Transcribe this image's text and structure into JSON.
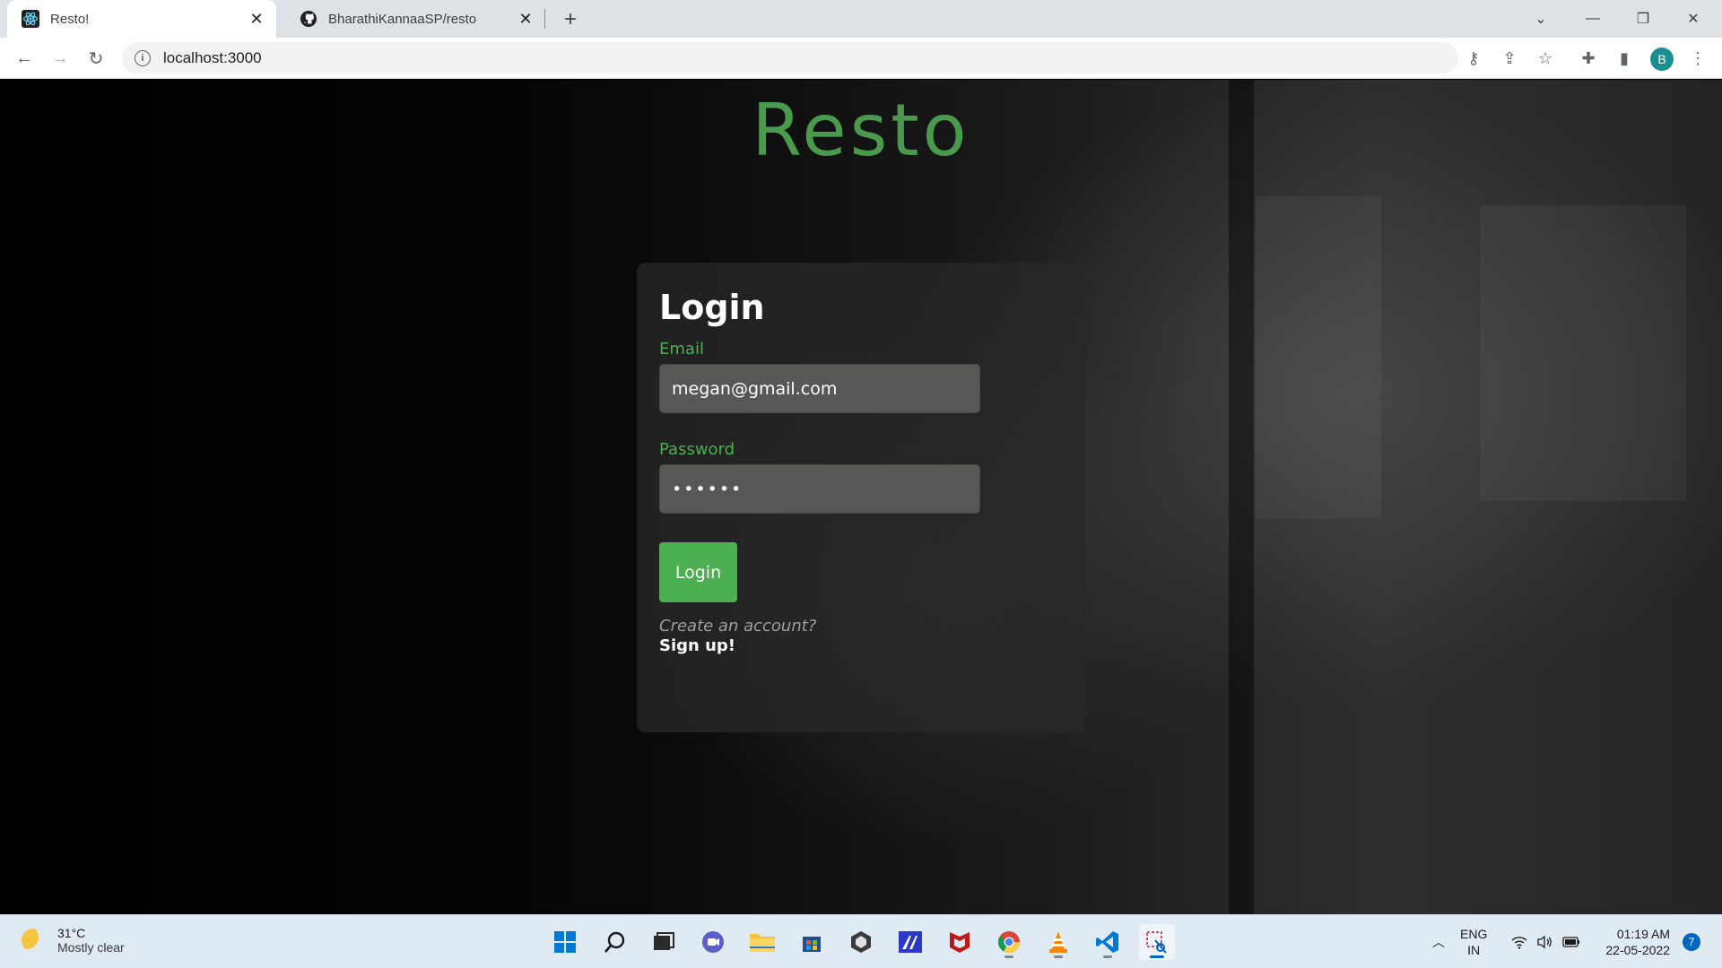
{
  "browser": {
    "tabs": [
      {
        "title": "Resto!",
        "icon": "react-icon",
        "active": true
      },
      {
        "title": "BharathiKannaaSP/resto",
        "icon": "github-icon",
        "active": false
      }
    ],
    "url": "localhost:3000",
    "profile_initial": "B",
    "profile_color": "#1a8f8f"
  },
  "page": {
    "logo": "Resto",
    "logo_color": "#4a9a4e",
    "form": {
      "title": "Login",
      "email_label": "Email",
      "email_value": "megan@gmail.com",
      "password_label": "Password",
      "password_value": "••••••",
      "login_button": "Login",
      "create_account_text": "Create an account?",
      "signup_link": "Sign up!"
    },
    "accent_color": "#4caf50"
  },
  "taskbar": {
    "weather": {
      "temp": "31°C",
      "condition": "Mostly clear"
    },
    "apps": [
      {
        "name": "start-icon",
        "active": false
      },
      {
        "name": "search-icon",
        "active": false
      },
      {
        "name": "task-view-icon",
        "active": false
      },
      {
        "name": "chat-icon",
        "active": false
      },
      {
        "name": "file-explorer-icon",
        "active": false
      },
      {
        "name": "store-icon",
        "active": false
      },
      {
        "name": "unity-icon",
        "active": false
      },
      {
        "name": "editor-icon",
        "active": false
      },
      {
        "name": "mcafee-icon",
        "active": false
      },
      {
        "name": "chrome-icon",
        "active": true
      },
      {
        "name": "vlc-icon",
        "active": true
      },
      {
        "name": "vscode-icon",
        "active": true
      },
      {
        "name": "snipping-tool-icon",
        "active": true
      }
    ],
    "language": {
      "line1": "ENG",
      "line2": "IN"
    },
    "clock": {
      "time": "01:19 AM",
      "date": "22-05-2022"
    },
    "notification_count": "7"
  }
}
